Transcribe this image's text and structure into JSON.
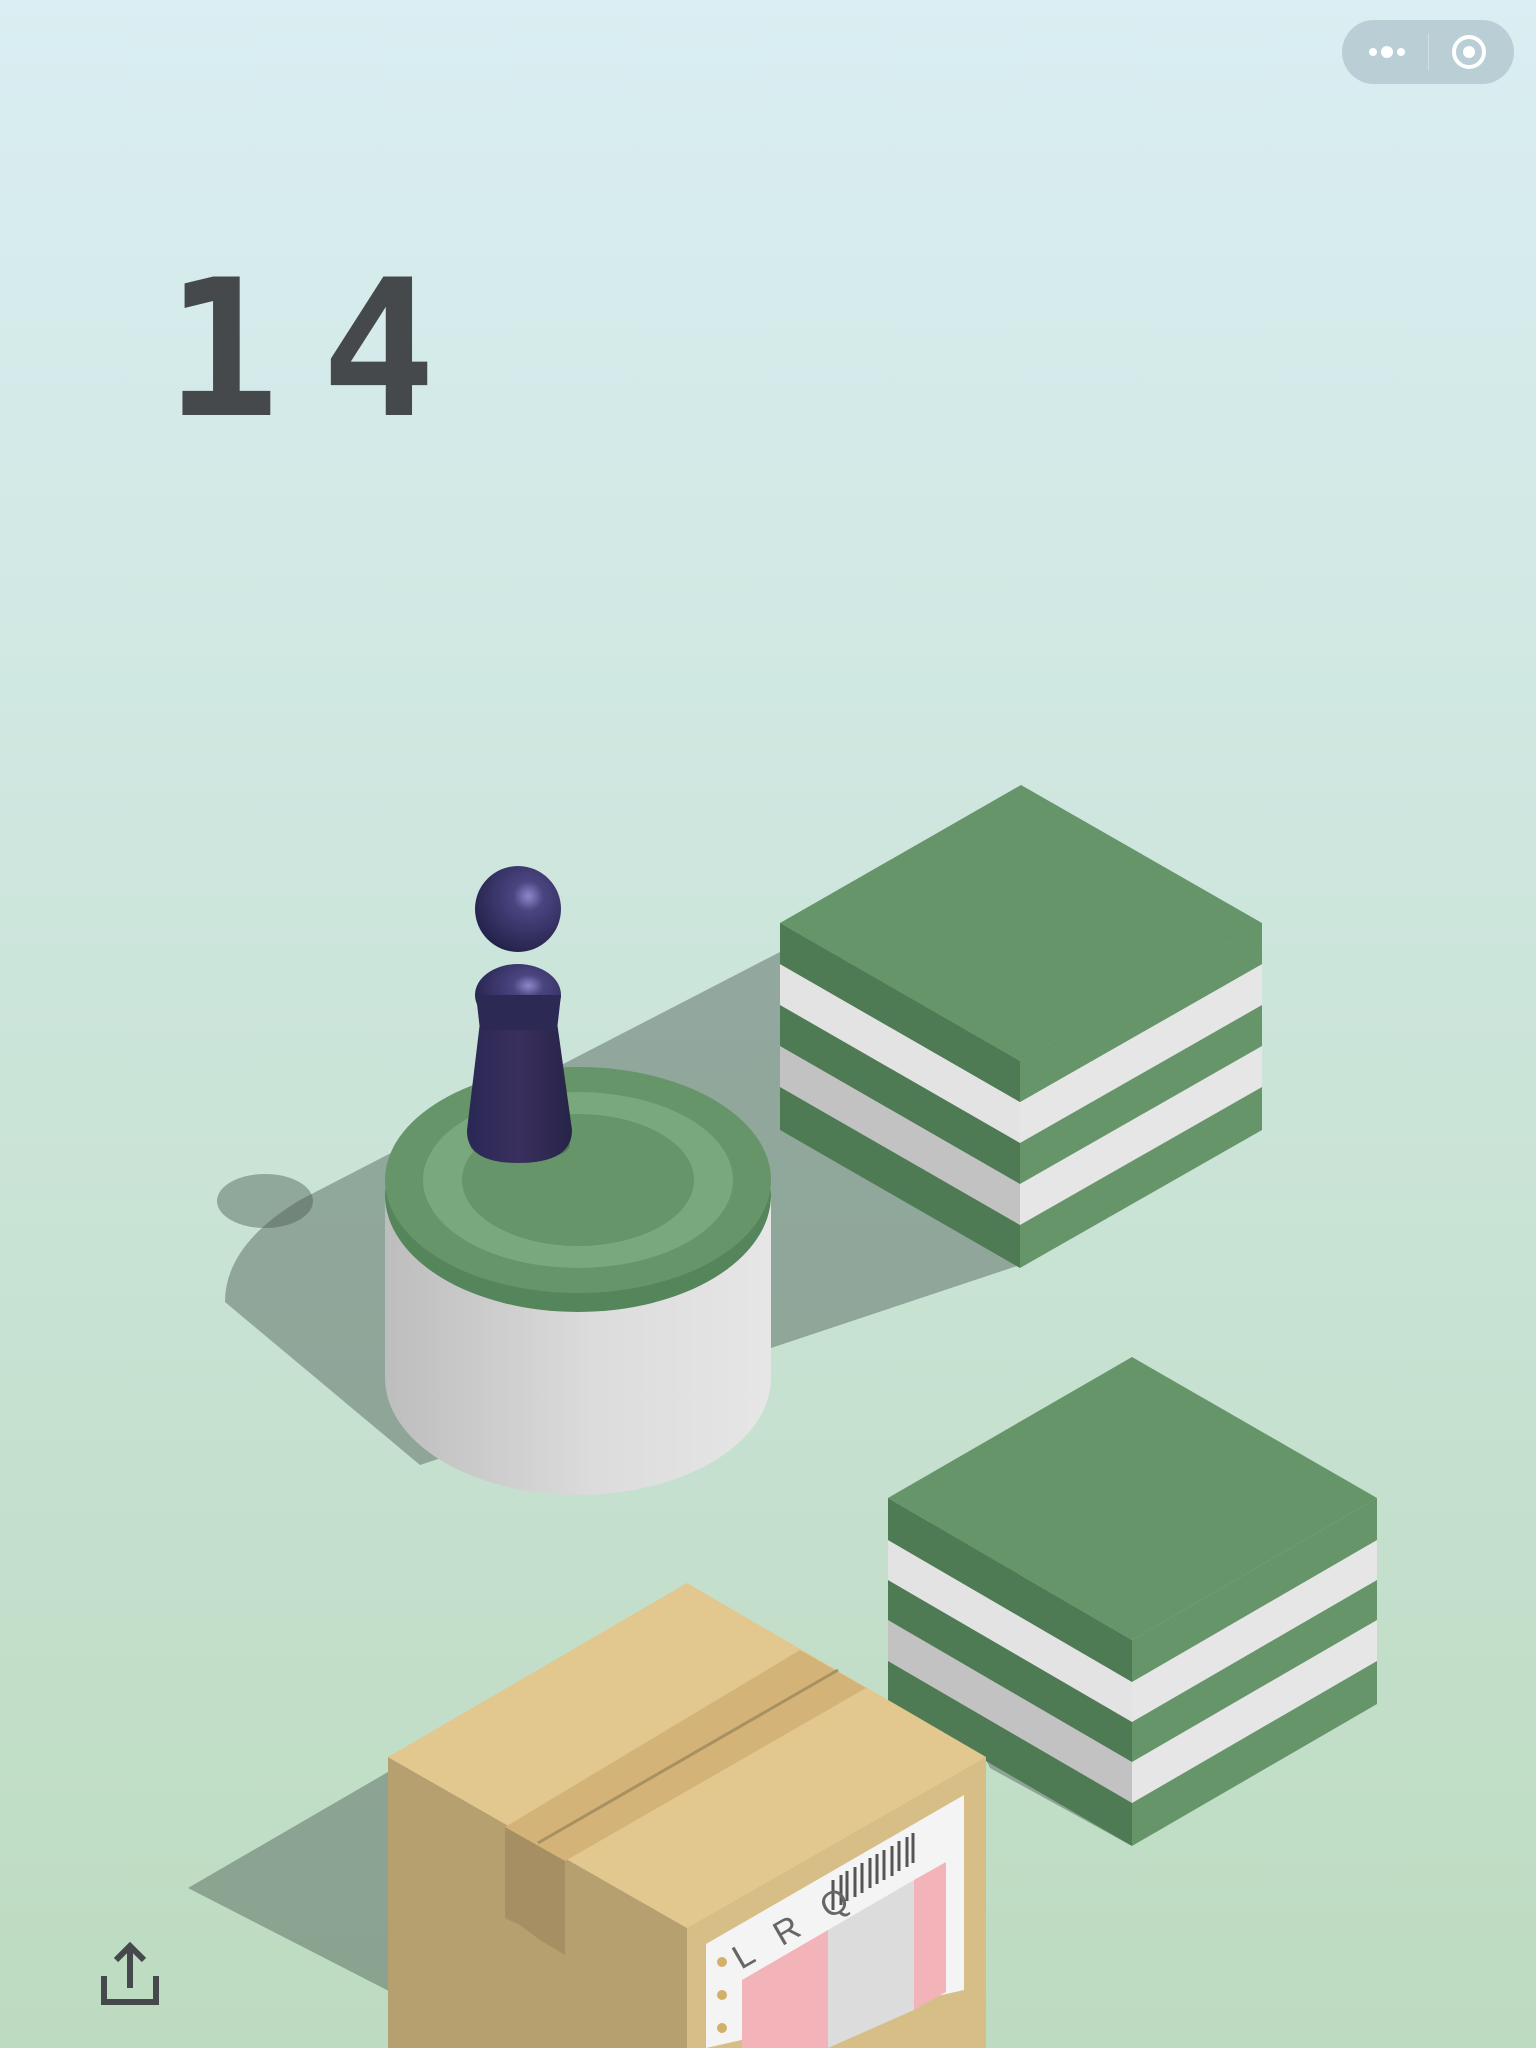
{
  "game": {
    "score": "14"
  },
  "top_bar": {
    "more_icon": "three-dots-icon",
    "close_icon": "target-circle-icon"
  },
  "bottom_bar": {
    "share_icon": "share-upload-icon"
  },
  "box_label": {
    "text": "L R Q"
  },
  "colors": {
    "bg_top": "#daeef3",
    "bg_bottom": "#bddbc0",
    "score": "#45494c",
    "green_top": "#66956a",
    "green_side_dark": "#4f7b54",
    "green_light_ring": "#79a87c",
    "stripe_white": "#e4e4e4",
    "stripe_gray": "#c3c3c3",
    "cylinder_side": "#d9d9d9",
    "box_top": "#e2c78f",
    "box_left": "#b7a06f",
    "box_right": "#d7bd86",
    "piece": "#2f2c56"
  }
}
